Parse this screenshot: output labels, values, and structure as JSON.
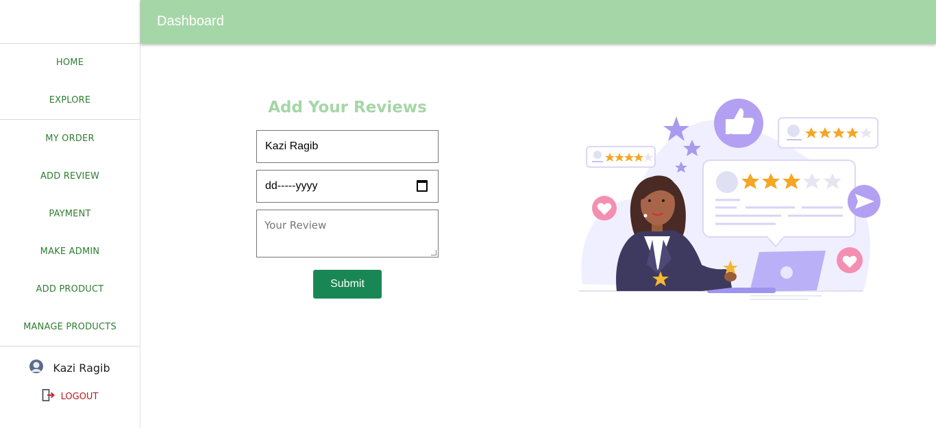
{
  "topbar": {
    "title": "Dashboard"
  },
  "sidebar": {
    "group1": [
      {
        "label": "HOME"
      },
      {
        "label": "EXPLORE"
      }
    ],
    "group2": [
      {
        "label": "MY ORDER"
      },
      {
        "label": "ADD REVIEW"
      },
      {
        "label": "PAYMENT"
      },
      {
        "label": "MAKE ADMIN"
      },
      {
        "label": "ADD PRODUCT"
      },
      {
        "label": "MANAGE PRODUCTS"
      }
    ],
    "user": {
      "name": "Kazi Ragib",
      "logout_label": "LOGOUT"
    }
  },
  "form": {
    "title": "Add Your Reviews",
    "name_value": "Kazi Ragib",
    "date_value": "dd-----yyyy",
    "review_placeholder": "Your Review",
    "submit_label": "Submit"
  },
  "colors": {
    "accent": "#a5d6a7",
    "nav_text": "#2e7d32",
    "submit": "#198754",
    "logout": "#b71c1c",
    "illustration_purple": "#b9a7f5",
    "star": "#f5a623",
    "heart": "#f06292"
  },
  "icons": {
    "user": "user-avatar-icon",
    "logout": "logout-icon",
    "calendar": "calendar-icon"
  }
}
